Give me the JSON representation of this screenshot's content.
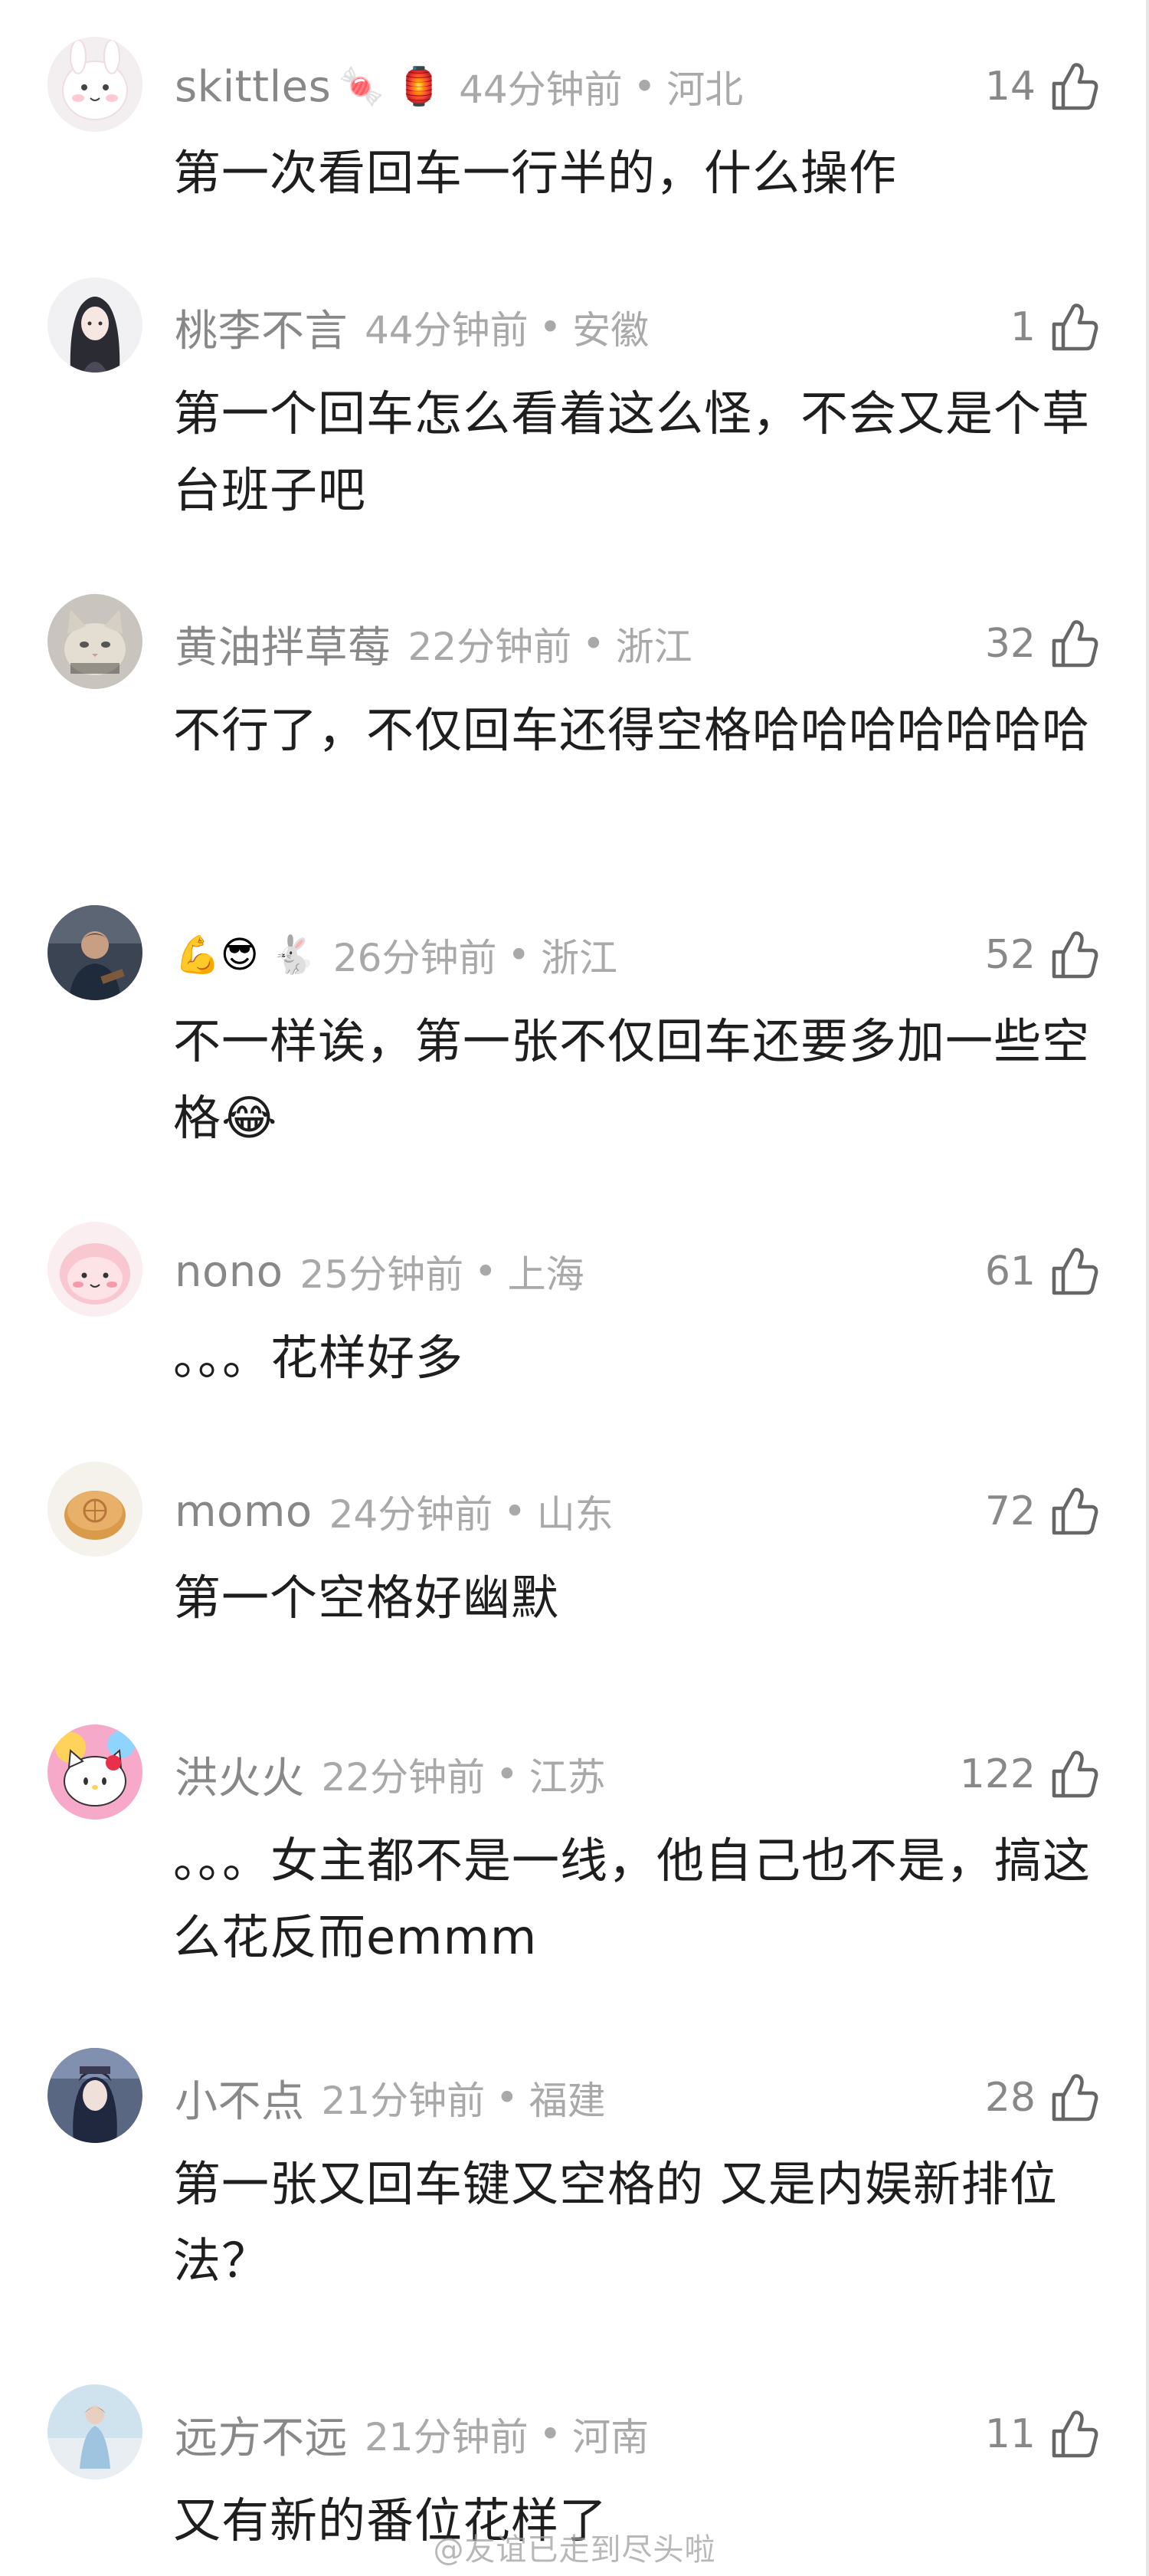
{
  "comments": [
    {
      "username": "skittles",
      "badges": "🍬 🏮",
      "time": "44分钟前",
      "location": "河北",
      "likes": "14",
      "text": "第一次看回车一行半的，什么操作",
      "avatar_icon": "cartoon-bunny-avatar"
    },
    {
      "username": "桃李不言",
      "badges": "",
      "time": "44分钟前",
      "location": "安徽",
      "likes": "1",
      "text": "第一个回车怎么看着这么怪，不会又是个草台班子吧",
      "avatar_icon": "anime-girl-avatar"
    },
    {
      "username": "黄油拌草莓",
      "badges": "",
      "time": "22分钟前",
      "location": "浙江",
      "likes": "32",
      "text": "不行了，不仅回车还得空格哈哈哈哈哈哈哈",
      "avatar_icon": "cat-avatar"
    },
    {
      "username": "",
      "badges": "💪😎 🐇",
      "time": "26分钟前",
      "location": "浙江",
      "likes": "52",
      "text": "不一样诶，第一张不仅回车还要多加一些空格😂",
      "avatar_icon": "photo-person-avatar"
    },
    {
      "username": "nono",
      "badges": "",
      "time": "25分钟前",
      "location": "上海",
      "likes": "61",
      "text": "。。。花样好多",
      "avatar_icon": "pink-character-avatar"
    },
    {
      "username": "momo",
      "badges": "",
      "time": "24分钟前",
      "location": "山东",
      "likes": "72",
      "text": "第一个空格好幽默",
      "avatar_icon": "mooncake-avatar"
    },
    {
      "username": "洪火火",
      "badges": "",
      "time": "22分钟前",
      "location": "江苏",
      "likes": "122",
      "text": "。。。女主都不是一线，他自己也不是，搞这么花反而emmm",
      "avatar_icon": "hello-kitty-avatar"
    },
    {
      "username": "小不点",
      "badges": "",
      "time": "21分钟前",
      "location": "福建",
      "likes": "28",
      "text": "第一张又回车键又空格的  又是内娱新排位法？",
      "avatar_icon": "anime-character-avatar"
    },
    {
      "username": "远方不远",
      "badges": "",
      "time": "21分钟前",
      "location": "河南",
      "likes": "11",
      "text": "又有新的番位花样了",
      "avatar_icon": "figure-beach-avatar"
    }
  ],
  "separator": "•",
  "watermark": "@友谊已走到尽头啦",
  "colors": {
    "username": "#888888",
    "meta": "#a9a9a9",
    "text": "#1e1e1e",
    "like_icon": "#666666"
  }
}
